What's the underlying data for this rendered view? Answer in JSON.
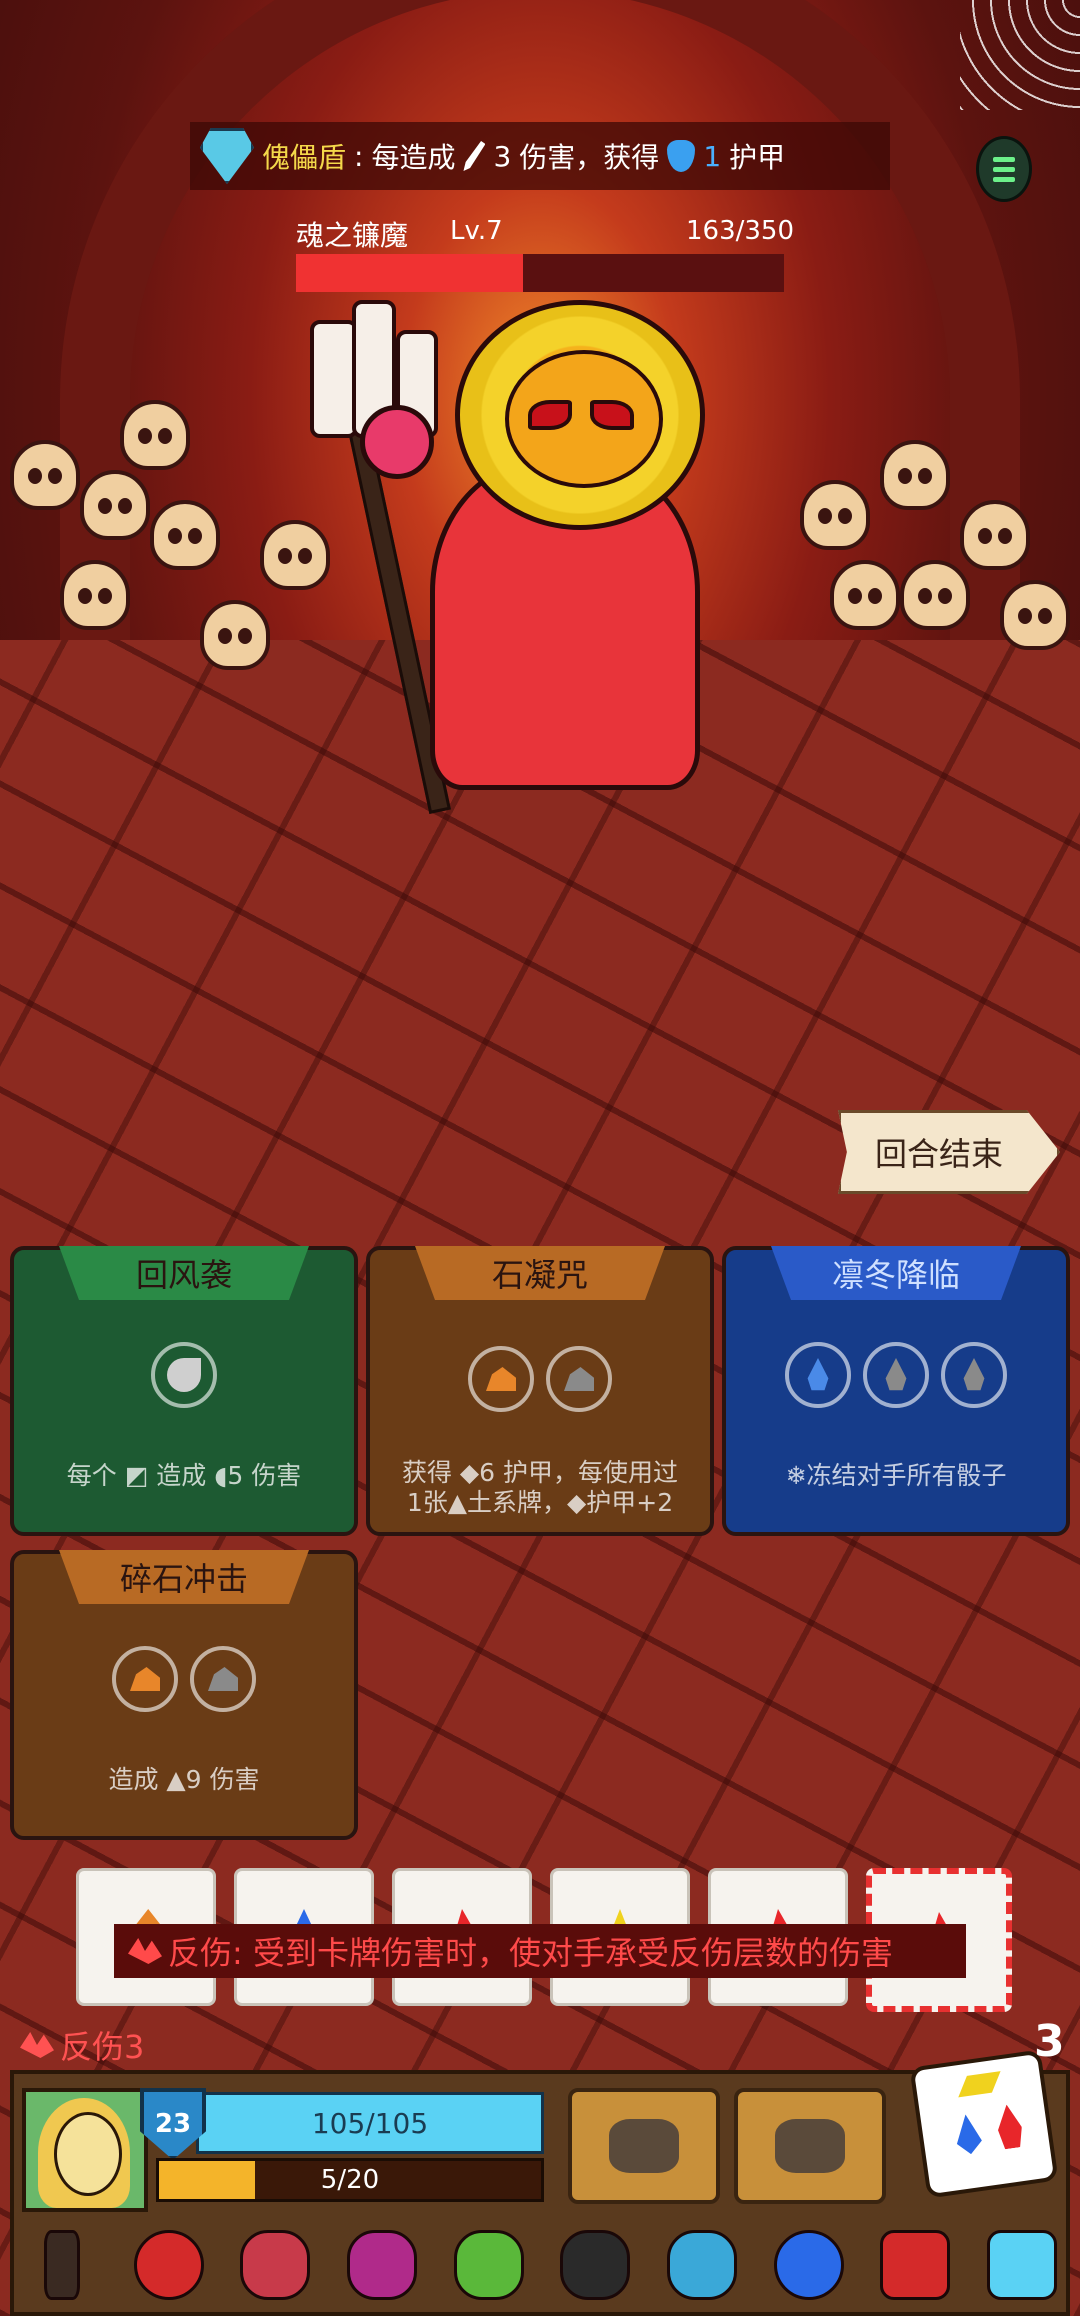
{
  "banner": {
    "skill_name": "傀儡盾",
    "colon": ":",
    "text_a": "每造成",
    "attack_value": "3",
    "text_b": "伤害，获得",
    "armor_value": "1",
    "text_c": "护甲"
  },
  "boss": {
    "name": "魂之镰魔",
    "level": "Lv.7",
    "hp_text": "163/350",
    "hp_current": 163,
    "hp_max": 350
  },
  "end_turn_label": "回合结束",
  "cards": [
    {
      "title": "回风袭",
      "desc": "每个 ◩ 造成 ◖5 伤害"
    },
    {
      "title": "石凝咒",
      "desc_line1": "获得 ◆6 护甲，每使用过",
      "desc_line2": "1张▲土系牌，◆护甲+2"
    },
    {
      "title": "凛冬降临",
      "desc": "❄冻结对手所有骰子"
    },
    {
      "title": "碎石冲击",
      "desc": "造成 ▲9 伤害"
    }
  ],
  "dice": [
    "rock",
    "water",
    "fire",
    "gold",
    "fire",
    "fire"
  ],
  "tooltip": "反伤: 受到卡牌伤害时，使对手承受反伤层数的伤害",
  "status": "反伤3",
  "turn_counter": "3",
  "player": {
    "level": "23",
    "hp_text": "105/105",
    "hp_current": 105,
    "hp_max": 105,
    "xp_text": "5/20",
    "xp_current": 5,
    "xp_max": 20
  },
  "relics": [
    "dagger-icon",
    "serpent-ring-icon",
    "rune-shield-icon",
    "crown-icon",
    "clover-icon",
    "skull-icon",
    "crystal-skull-icon",
    "spiked-orb-icon",
    "fire-die-icon",
    "ice-crystal-icon"
  ],
  "colors": {
    "hp_blue": "#5ad2f4",
    "boss_hp": "#f03232",
    "xp_gold": "#f4b42a",
    "status_red": "#ff5252"
  }
}
